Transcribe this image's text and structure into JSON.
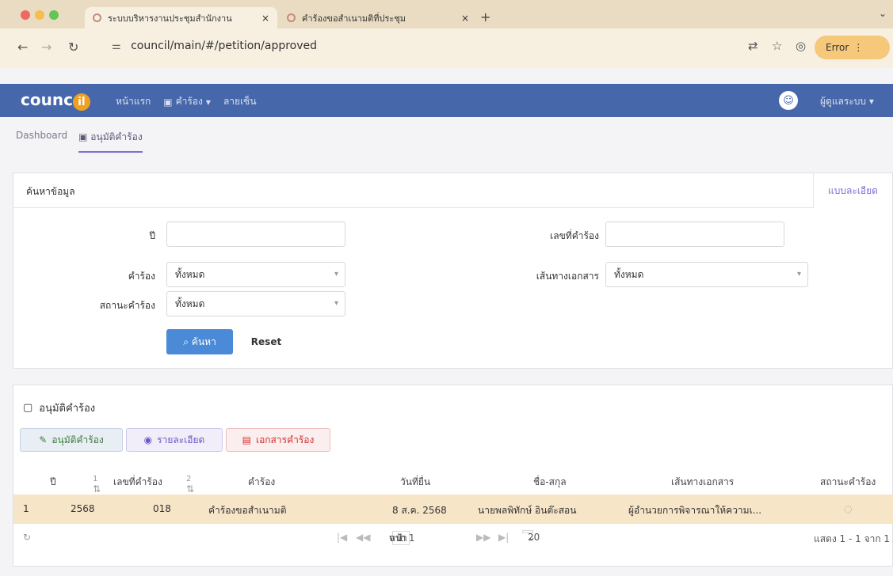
{
  "browser": {
    "tabs": [
      {
        "label": "ระบบบริหารงานประชุมสำนักงาน",
        "close": "×"
      },
      {
        "label": "คำร้องขอสำเนามติที่ประชุม",
        "close": "×"
      }
    ],
    "new_tab": "+",
    "tab_menu": "⌄",
    "url": "council/main/#/petition/approved",
    "error_label": "Error"
  },
  "app": {
    "logo_text": "counc",
    "logo_badge": "il",
    "nav": {
      "home": "หน้าแรก",
      "petition": "คำร้อง",
      "signature": "ลายเซ็น"
    },
    "user": "ผู้ดูแลระบบ"
  },
  "breadcrumb": {
    "dashboard": "Dashboard",
    "current": "อนุมัติคำร้อง"
  },
  "search": {
    "title": "ค้นหาข้อมูล",
    "detail_tab": "แบบละเอียด",
    "fields": {
      "year_label": "ปี",
      "year_value": "",
      "petition_no_label": "เลขที่คำร้อง",
      "petition_no_value": "",
      "petition_label": "คำร้อง",
      "petition_value": "ทั้งหมด",
      "route_label": "เส้นทางเอกสาร",
      "route_value": "ทั้งหมด",
      "status_label": "สถานะคำร้อง",
      "status_value": "ทั้งหมด"
    },
    "search_button": "ค้นหา",
    "reset_button": "Reset"
  },
  "results": {
    "title": "อนุมัติคำร้อง",
    "actions": {
      "approve": "อนุมัติคำร้อง",
      "detail": "รายละเอียด",
      "document": "เอกสารคำร้อง"
    },
    "columns": {
      "year": "ปี",
      "sort1": "1",
      "petition_no": "เลขที่คำร้อง",
      "sort2": "2",
      "petition": "คำร้อง",
      "date": "วันที่ยื่น",
      "name": "ชื่อ-สกุล",
      "route": "เส้นทางเอกสาร",
      "status": "สถานะคำร้อง"
    },
    "rows": [
      {
        "index": "1",
        "year": "2568",
        "petition_no": "018",
        "petition": "คำร้องขอสำเนามติ",
        "date": "8 ส.ค. 2568",
        "name": "นายพลพิทักษ์ อินต๊ะสอน",
        "route": "ผู้อำนวยการพิจารณาให้ความเ..."
      }
    ],
    "pager": {
      "page_label": "หน้า",
      "page": "1",
      "of_label": "จาก 1",
      "page_size": "20",
      "summary": "แสดง 1 - 1 จาก 1"
    }
  },
  "colors": {
    "nav_bg": "#4767ab",
    "accent": "#7b6fd6",
    "selected_row": "#f6e5c7",
    "search_button": "#4b8ad6"
  }
}
